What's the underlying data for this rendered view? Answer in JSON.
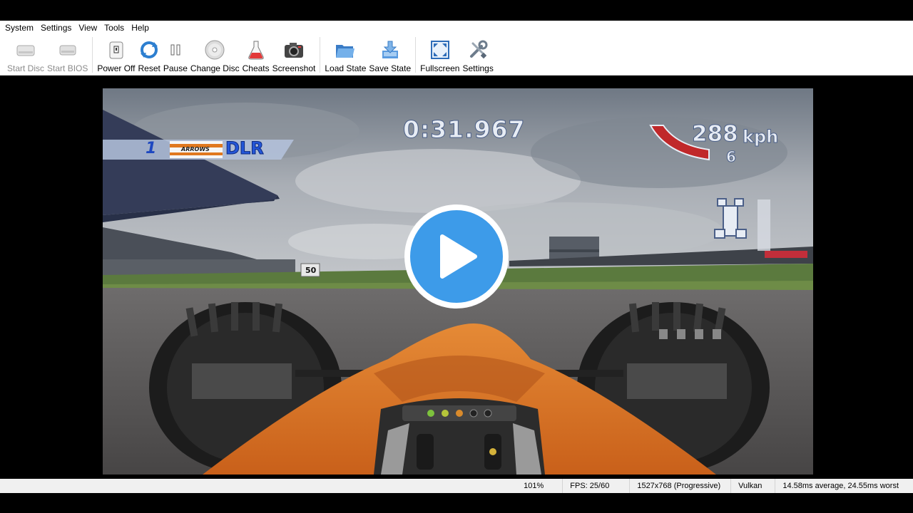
{
  "menubar": {
    "items": [
      "System",
      "Settings",
      "View",
      "Tools",
      "Help"
    ]
  },
  "toolbar": {
    "start_disc": "Start Disc",
    "start_bios": "Start BIOS",
    "power_off": "Power Off",
    "reset": "Reset",
    "pause": "Pause",
    "change_disc": "Change Disc",
    "cheats": "Cheats",
    "screenshot": "Screenshot",
    "load_state": "Load State",
    "save_state": "Save State",
    "fullscreen": "Fullscreen",
    "settings": "Settings"
  },
  "game_hud": {
    "lap_time": "0:31.967",
    "speed": "288",
    "speed_unit": "kph",
    "gear": "6",
    "position": "1",
    "team": "ARROWS",
    "driver": "DLR",
    "distance_marker": "50"
  },
  "statusbar": {
    "zoom": "101%",
    "fps": "FPS: 25/60",
    "resolution": "1527x768 (Progressive)",
    "renderer": "Vulkan",
    "frame_time": "14.58ms average, 24.55ms worst"
  },
  "colors": {
    "play_button": "#3d9be9",
    "car_orange": "#e0781e",
    "speed_arc": "#c0282a"
  }
}
